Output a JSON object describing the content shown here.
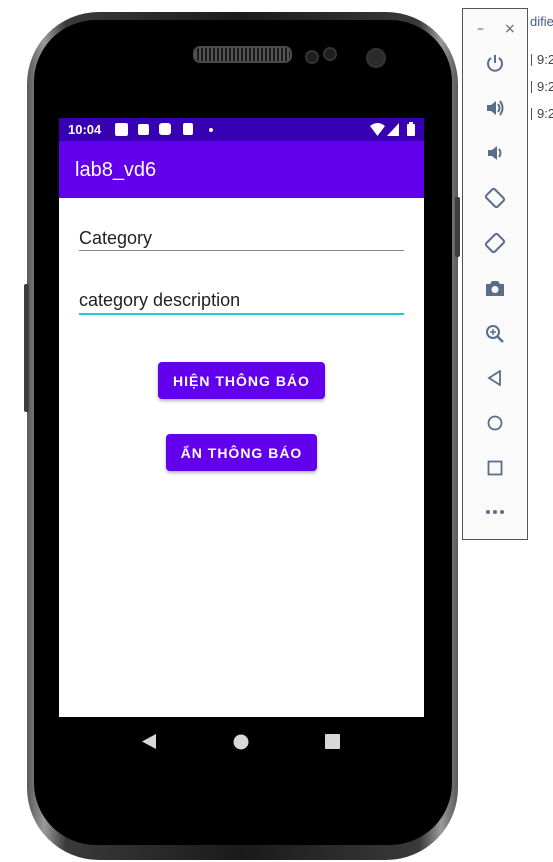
{
  "background": {
    "truncated_header": "difie",
    "times": [
      "9:2",
      "9:2",
      "9:2"
    ]
  },
  "status_bar": {
    "time": "10:04",
    "bg_color": "#3700b3"
  },
  "app_bar": {
    "title": "lab8_vd6",
    "bg_color": "#6200ee"
  },
  "form": {
    "category_field": {
      "value": "Category"
    },
    "description_field": {
      "value": "category description"
    }
  },
  "buttons": {
    "show_label": "HIỆN THÔNG BÁO",
    "hide_label": "ẨN THÔNG BÁO"
  },
  "nav_bar": {
    "back_icon": "back-triangle",
    "home_icon": "home-circle",
    "recents_icon": "recents-square"
  },
  "emulator_toolbar": {
    "minimize_label": "–",
    "close_label": "×",
    "items": [
      "power",
      "volume-up",
      "volume-down",
      "rotate-left",
      "rotate-right",
      "screenshot",
      "zoom",
      "back",
      "home",
      "overview",
      "more"
    ],
    "accent_color": "#5a6e8a"
  }
}
